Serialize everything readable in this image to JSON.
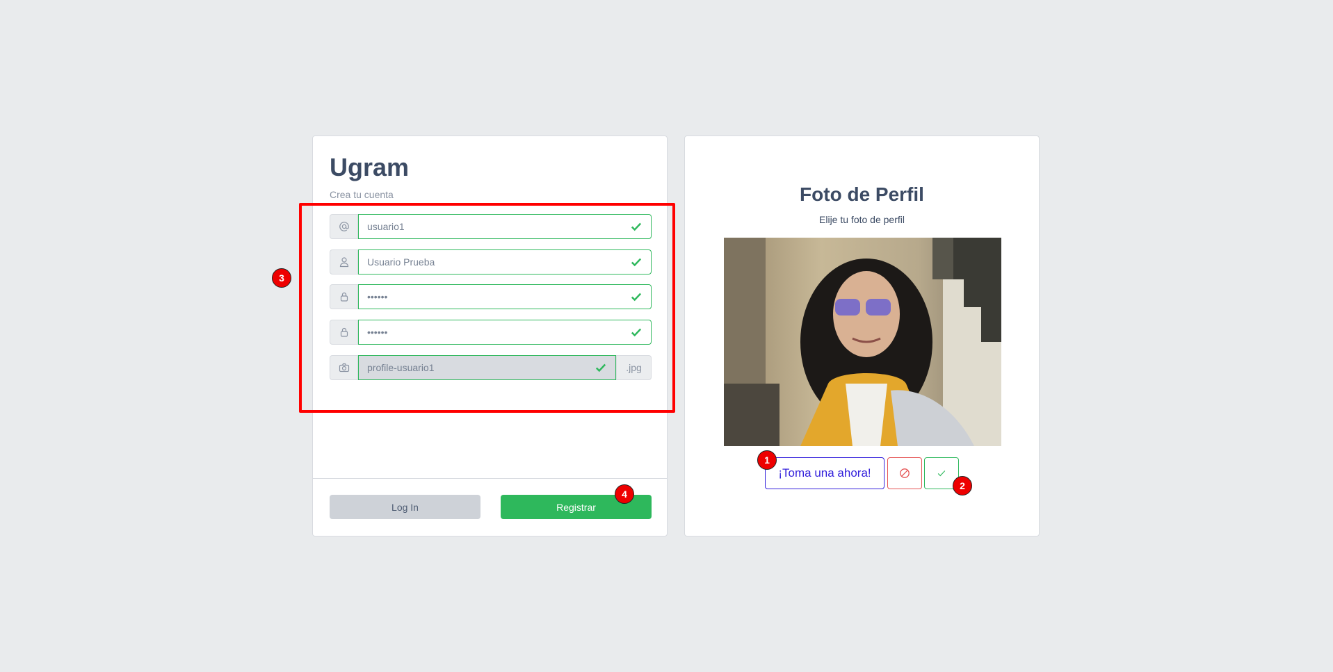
{
  "register": {
    "title": "Ugram",
    "subtitle": "Crea tu cuenta",
    "fields": [
      {
        "icon": "at-icon",
        "value": "usuario1"
      },
      {
        "icon": "user-icon",
        "value": "Usuario Prueba"
      },
      {
        "icon": "lock-icon",
        "value": "••••••"
      },
      {
        "icon": "lock-icon",
        "value": "••••••"
      },
      {
        "icon": "camera-icon",
        "value": "profile-usuario1",
        "suffix": ".jpg"
      }
    ],
    "login_label": "Log In",
    "register_label": "Registrar"
  },
  "profile_photo": {
    "title": "Foto de Perfil",
    "subtitle": "Elije tu foto de perfil",
    "take_photo_label": "¡Toma una ahora!",
    "cancel_icon": "ban-icon",
    "accept_icon": "check-icon"
  },
  "annotations": {
    "badge_1": "1",
    "badge_2": "2",
    "badge_3": "3",
    "badge_4": "4"
  },
  "colors": {
    "primary": "#321fdb",
    "success": "#2eb85c",
    "danger": "#e55353",
    "annotation": "#ff0000"
  }
}
